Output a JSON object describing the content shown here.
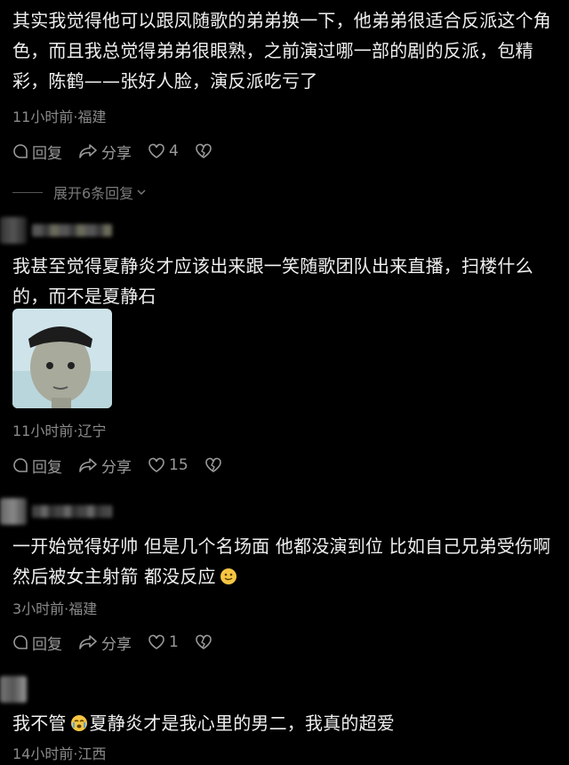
{
  "comments": [
    {
      "text": "其实我觉得他可以跟凤随歌的弟弟换一下，他弟弟很适合反派这个角色，而且我总觉得弟弟很眼熟，之前演过哪一部的剧的反派，包精彩，陈鹤——张好人脸，演反派吃亏了",
      "meta": "11小时前·福建",
      "reply": "回复",
      "share": "分享",
      "likes": "4",
      "expand": "展开6条回复"
    },
    {
      "text": "我甚至觉得夏静炎才应该出来跟一笑随歌团队出来直播，扫楼什么的，而不是夏静石",
      "meta": "11小时前·辽宁",
      "reply": "回复",
      "share": "分享",
      "likes": "15"
    },
    {
      "text_before": "一开始觉得好帅 但是几个名场面 他都没演到位 比如自己兄弟受伤啊 然后被女主射箭 都没反应",
      "meta": "3小时前·福建",
      "reply": "回复",
      "share": "分享",
      "likes": "1"
    },
    {
      "text_before": "我不管",
      "text_after": "夏静炎才是我心里的男二，我真的超爱",
      "meta": "14小时前·江西"
    }
  ],
  "icons": [
    "reply-icon",
    "share-icon",
    "heart-icon",
    "broken-heart-icon",
    "chevron-down-icon",
    "smile-emoji",
    "cry-emoji"
  ]
}
